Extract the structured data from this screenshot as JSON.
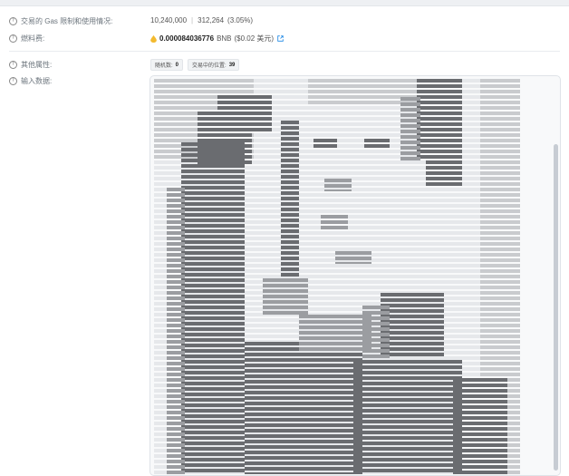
{
  "gas_limit_usage": {
    "label": "交易的 Gas 限制和使用情况:",
    "limit": "10,240,000",
    "used": "312,264",
    "percent": "(3.05%)"
  },
  "gas_price": {
    "label": "燃料费:",
    "amount": "0.000084036776",
    "unit": "BNB",
    "fiat": "($0.02 美元)"
  },
  "other_attributes": {
    "label": "其他属性:",
    "badges": [
      {
        "name": "随机数:",
        "value": "0"
      },
      {
        "name": "交易中的位置:",
        "value": "39"
      }
    ]
  },
  "input_data": {
    "label": "输入数据:"
  },
  "colors": {
    "link": "#1e88e5",
    "bnb": "#f3ba2f",
    "ascii_dark": "#6a6c70"
  }
}
